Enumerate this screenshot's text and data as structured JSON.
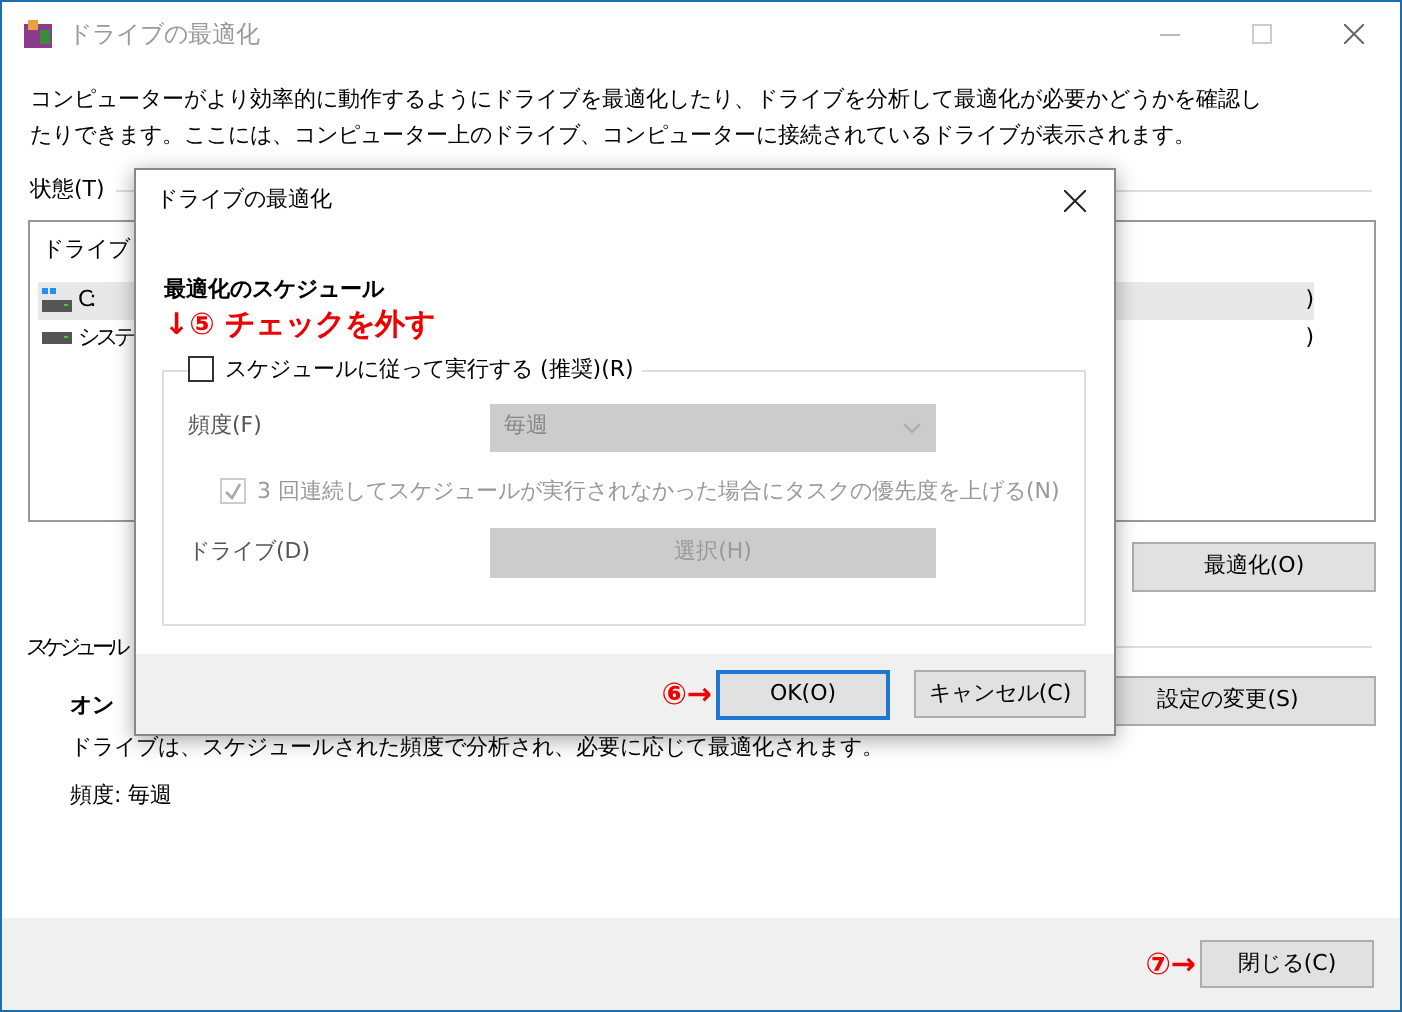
{
  "window": {
    "title": "ドライブの最適化",
    "description": "コンピューターがより効率的に動作するようにドライブを最適化したり、ドライブを分析して最適化が必要かどうかを確認したりできます。ここには、コンピューター上のドライブ、コンピューターに接続されているドライブが表示されます。"
  },
  "status": {
    "label": "状態(T)",
    "columns": [
      "ドライブ"
    ],
    "rows": [
      {
        "name": "C:",
        "tail": ")",
        "kind": "system",
        "selected": true
      },
      {
        "name": "システ",
        "tail": ")",
        "kind": "disk",
        "selected": false
      }
    ],
    "optimize_button": "最適化(O)"
  },
  "schedule": {
    "label": "スケジュール",
    "state": "オン",
    "description": "ドライブは、スケジュールされた頻度で分析され、必要に応じて最適化されます。",
    "frequency": "頻度: 毎週",
    "change_button": "設定の変更(S)"
  },
  "close_button": {
    "label": "閉じる(C)",
    "annotation": "⑦→"
  },
  "dialog": {
    "title": "ドライブの最適化",
    "heading": "最適化のスケジュール",
    "annotation": "↓⑤ チェックを外す",
    "run_on_schedule": {
      "label": "スケジュールに従って実行する (推奨)(R)",
      "checked": false
    },
    "frequency": {
      "label": "頻度(F)",
      "value": "毎週",
      "disabled": true
    },
    "raise_priority": {
      "label": "3 回連続してスケジュールが実行されなかった場合にタスクの優先度を上げる(N)",
      "checked": true,
      "disabled": true
    },
    "drives": {
      "label": "ドライブ(D)",
      "button": "選択(H)",
      "disabled": true
    },
    "ok_button": {
      "label": "OK(O)",
      "annotation": "⑥→"
    },
    "cancel_button": "キャンセル(C)"
  }
}
